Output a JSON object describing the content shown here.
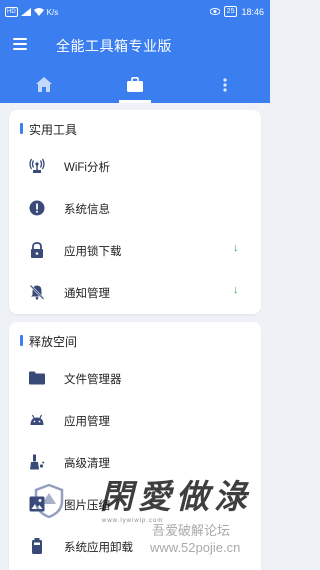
{
  "status_bar": {
    "left_icons": [
      "hd-icon",
      "signal-icon",
      "wifi-icon"
    ],
    "speed": "K/s",
    "battery": "25",
    "time": "18:46"
  },
  "app": {
    "title": "全能工具箱专业版",
    "accent_color": "#3b7ef0"
  },
  "tabs": [
    {
      "name": "home",
      "icon": "home-icon",
      "selected": false
    },
    {
      "name": "toolbox",
      "icon": "toolbox-icon",
      "selected": true
    },
    {
      "name": "more",
      "icon": "more-vertical-icon",
      "selected": false
    }
  ],
  "sections": [
    {
      "title": "实用工具",
      "items": [
        {
          "label": "WiFi分析",
          "icon": "wifi-antenna-icon",
          "download": false
        },
        {
          "label": "系统信息",
          "icon": "info-icon",
          "download": false
        },
        {
          "label": "应用锁下载",
          "icon": "lock-icon",
          "download": true
        },
        {
          "label": "通知管理",
          "icon": "bell-off-icon",
          "download": true
        }
      ]
    },
    {
      "title": "释放空间",
      "items": [
        {
          "label": "文件管理器",
          "icon": "folder-icon"
        },
        {
          "label": "应用管理",
          "icon": "android-icon"
        },
        {
          "label": "高级清理",
          "icon": "broom-icon"
        },
        {
          "label": "图片压缩",
          "icon": "image-icon"
        },
        {
          "label": "系统应用卸载",
          "icon": "battery-app-icon"
        }
      ]
    }
  ],
  "download_symbol": "↓",
  "watermark": {
    "big_text": "閑愛做淥",
    "url": "www.lywlwlp.com",
    "forum": "吾爱破解论坛",
    "site": "www.52pojie.cn"
  }
}
